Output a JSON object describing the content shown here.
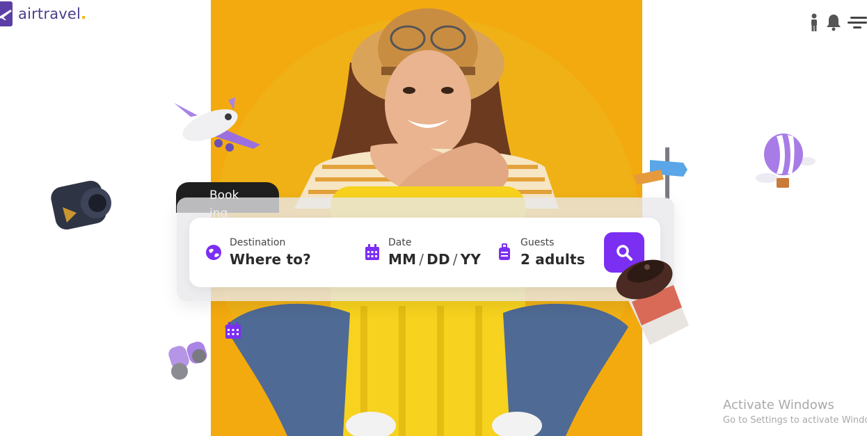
{
  "brand": {
    "name": "airtravel",
    "dot": "."
  },
  "header": {
    "icons": [
      "person-icon",
      "bell-icon",
      "menu-icon"
    ]
  },
  "booking": {
    "tab_label": "Booking",
    "destination": {
      "label": "Destination",
      "value": "Where to?",
      "icon": "globe-icon"
    },
    "date": {
      "label": "Date",
      "month": "MM",
      "day": "DD",
      "year": "YY",
      "separator": "/",
      "icon": "calendar-icon"
    },
    "guests": {
      "label": "Guests",
      "value": "2 adults",
      "icon": "luggage-icon"
    },
    "search_icon": "search-icon"
  },
  "colors": {
    "accent": "#7b2ff2",
    "hero": "#f3aa0f",
    "logo": "#4a3f8c",
    "tab": "#1f1f1f"
  },
  "watermark": {
    "title": "Activate Windows",
    "subtitle": "Go to Settings to activate Windows."
  }
}
